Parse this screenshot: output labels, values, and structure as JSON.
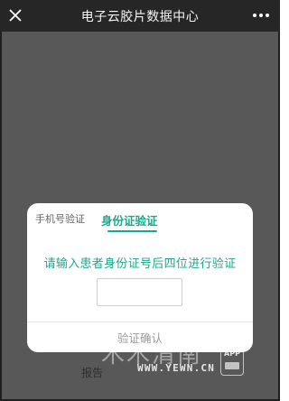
{
  "topbar": {
    "title": "电子云胶片数据中心",
    "close_icon": "close-icon",
    "more_icon": "more-horizontal-icon"
  },
  "modal": {
    "tabs": [
      {
        "label": "手机号验证",
        "active": false
      },
      {
        "label": "身份证验证",
        "active": true
      }
    ],
    "prompt": "请输入患者身份证号后四位进行验证",
    "input": {
      "value": "",
      "placeholder": ""
    },
    "confirm_label": "验证确认"
  },
  "background": {
    "partial_text": "报告"
  },
  "watermark": {
    "main": "木木清南",
    "url": "WWW.YEWN.CN",
    "badge": "APP"
  },
  "colors": {
    "accent": "#17a98a",
    "overlay": "#585858",
    "topbar": "#262626"
  }
}
